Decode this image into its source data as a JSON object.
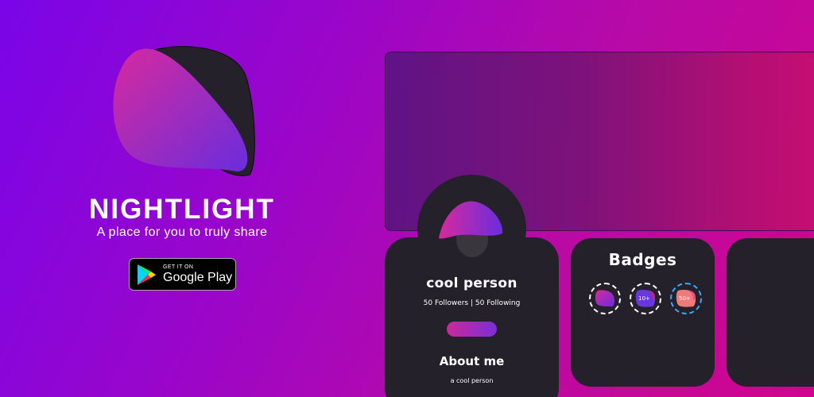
{
  "brand": {
    "name": "NIGHTLIGHT",
    "tagline": "A place for you to truly share",
    "logo_icon": "nightlight-logo-icon"
  },
  "store_badge": {
    "small_label": "GET IT ON",
    "big_label": "Google Play",
    "icon": "google-play-icon"
  },
  "profile": {
    "username": "cool person",
    "stats": "50 Followers | 50 Following",
    "about_heading": "About me",
    "about_text": "a cool person",
    "avatar_icon": "nightlight-avatar-icon"
  },
  "badges": {
    "title": "Badges",
    "items": [
      {
        "icon": "logo-badge-icon",
        "label": ""
      },
      {
        "icon": "ten-plus-badge-icon",
        "label": "10+"
      },
      {
        "icon": "fifty-plus-badge-icon",
        "label": "50+"
      }
    ]
  },
  "colors": {
    "background_start": "#7a05e8",
    "background_end": "#d1058c",
    "card": "#25212a",
    "accent_pink": "#c92a9a",
    "accent_purple": "#7a2fd6",
    "badge_ring_blue": "#3aa7ff"
  }
}
